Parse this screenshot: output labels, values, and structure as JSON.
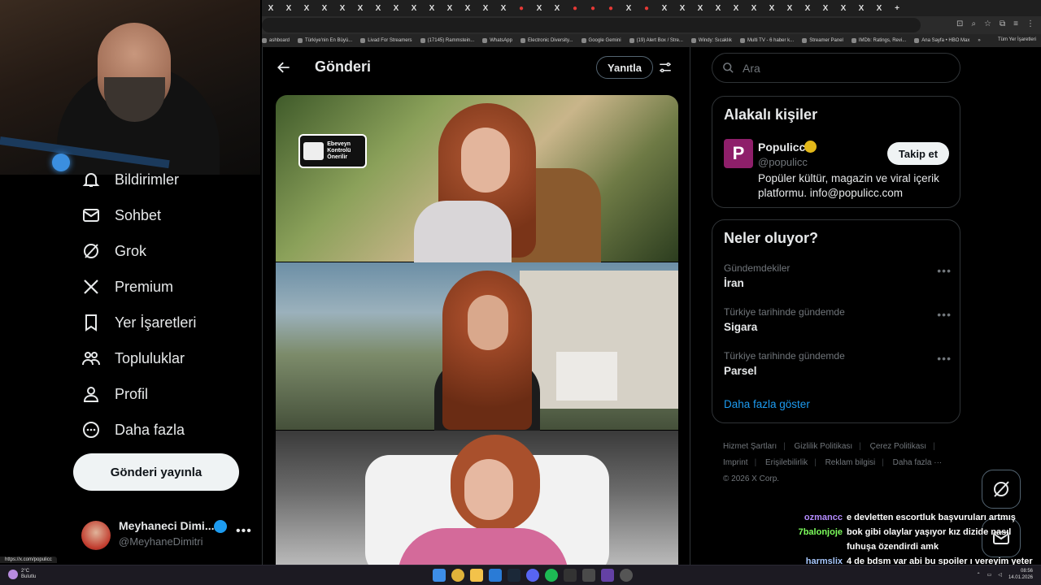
{
  "browser": {
    "tab_glyphs": [
      "X",
      "X",
      "X",
      "X",
      "X",
      "X",
      "X",
      "X",
      "X",
      "X",
      "X",
      "X",
      "X",
      "X",
      "●",
      "X",
      "X",
      "●",
      "●",
      "●",
      "X",
      "●",
      "X",
      "X",
      "X",
      "X",
      "X",
      "X",
      "X",
      "X",
      "X",
      "X",
      "X",
      "X",
      "X",
      "+"
    ],
    "bookmarks": [
      "ashboard",
      "Türkiye'nin En Büyü...",
      "Livad For Streamers",
      "(17145) Rammstein...",
      "WhatsApp",
      "Electronic Diversity...",
      "Google Gemini",
      "(19) Alert Box / Stre...",
      "Windy: Sıcaklık",
      "Multi TV - 6 haber k...",
      "Streamer Panel",
      "IMDb: Ratings, Revi...",
      "Ana Sayfa • HBO Max"
    ],
    "bookmarks_more": "»",
    "all_bookmarks": "Tüm Yer İşaretleri",
    "status_url": "https://x.com/populicc"
  },
  "nav": {
    "items": [
      {
        "label": "Bildirimler",
        "icon": "bell-icon"
      },
      {
        "label": "Sohbet",
        "icon": "mail-icon"
      },
      {
        "label": "Grok",
        "icon": "grok-icon"
      },
      {
        "label": "Premium",
        "icon": "x-logo-icon"
      },
      {
        "label": "Yer İşaretleri",
        "icon": "bookmark-icon"
      },
      {
        "label": "Topluluklar",
        "icon": "communities-icon"
      },
      {
        "label": "Profil",
        "icon": "person-icon"
      },
      {
        "label": "Daha fazla",
        "icon": "more-circle-icon"
      }
    ],
    "post_button": "Gönderi yayınla",
    "account": {
      "name": "Meyhaneci Dimi...",
      "handle": "@MeyhaneDimitri",
      "more": "•••"
    }
  },
  "main": {
    "title": "Gönderi",
    "reply_button": "Yanıtla",
    "parental_badge": "Ebeveyn Kontrolü Önerilir"
  },
  "right": {
    "search_placeholder": "Ara",
    "people": {
      "title": "Alakalı kişiler",
      "avatar_letter": "P",
      "name": "Populicc",
      "handle": "@populicc",
      "bio": "Popüler kültür, magazin ve viral içerik platformu. info@populicc.com",
      "follow_button": "Takip et"
    },
    "trends": {
      "title": "Neler oluyor?",
      "items": [
        {
          "context": "Gündemdekiler",
          "topic": "İran"
        },
        {
          "context": "Türkiye tarihinde gündemde",
          "topic": "Sigara"
        },
        {
          "context": "Türkiye tarihinde gündemde",
          "topic": "Parsel"
        }
      ],
      "more_dots": "•••",
      "show_more": "Daha fazla göster"
    },
    "footer": {
      "links_row1": [
        "Hizmet Şartları",
        "Gizlilik Politikası",
        "Çerez Politikası"
      ],
      "links_row2": [
        "Imprint",
        "Erişilebilirlik",
        "Reklam bilgisi",
        "Daha fazla ···"
      ],
      "copyright": "© 2026 X Corp."
    }
  },
  "chat": [
    {
      "user": "ozmancc",
      "text": "e devletten escortluk başvuruları artmış",
      "color": "#b58cff"
    },
    {
      "user": "7balonjoje",
      "text": "bok gibi olaylar yaşıyor kız dizide nasıl fuhuşa özendirdi amk",
      "color": "#7dff5c"
    },
    {
      "user": "harmslix",
      "text": "4 de bdsm var abi bu spoiler ı vereyim yeter sana",
      "color": "#a8c8ff"
    }
  ],
  "taskbar": {
    "weather_temp": "2°C",
    "weather_desc": "Bulutlu",
    "time": "08:56",
    "date": "14.01.2026"
  },
  "colors": {
    "accent": "#1d9bf0",
    "bg": "#000000",
    "border": "#2f3336",
    "muted": "#71767b"
  }
}
